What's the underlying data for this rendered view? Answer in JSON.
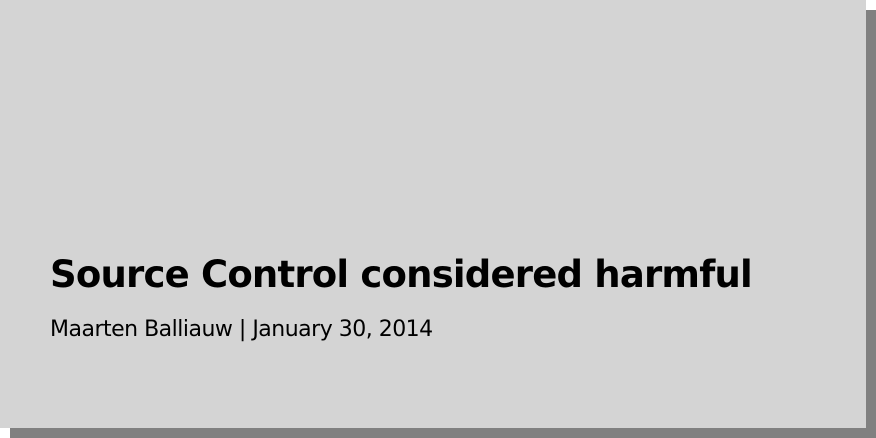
{
  "slide": {
    "title": "Source Control considered harmful",
    "byline": "Maarten Balliauw | January 30, 2014"
  }
}
